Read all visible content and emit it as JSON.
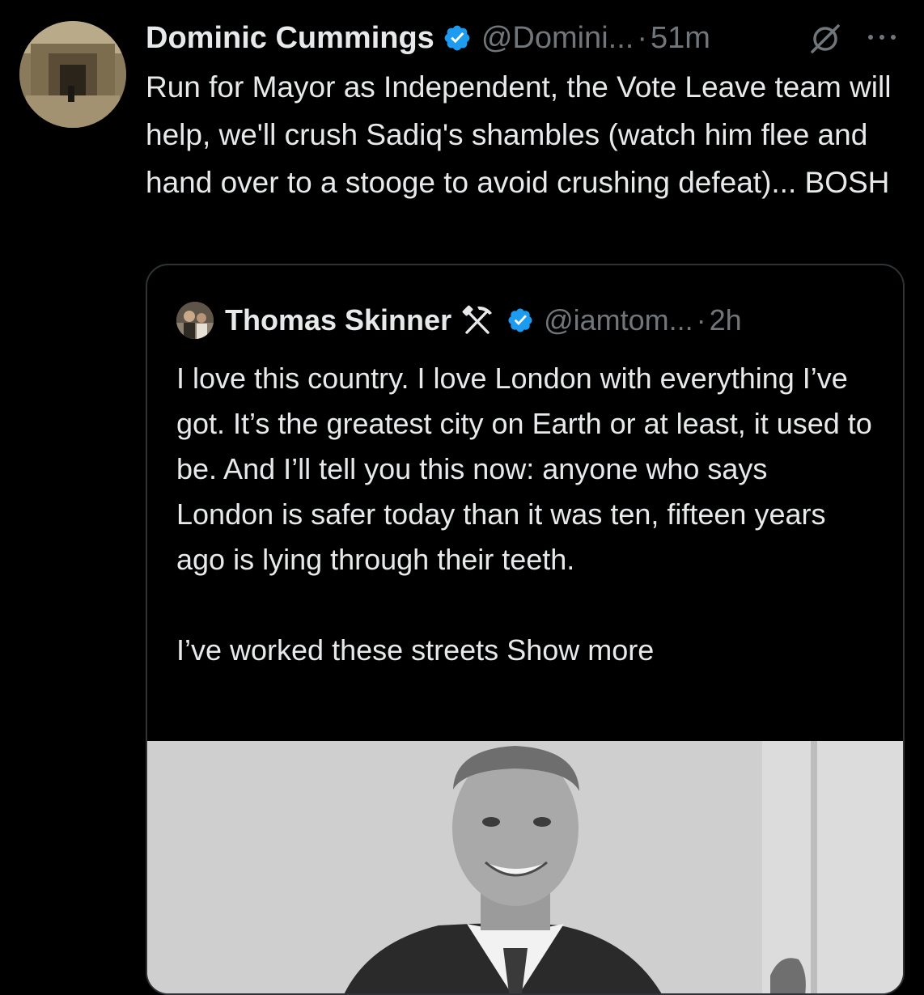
{
  "tweet": {
    "display_name": "Dominic Cummings",
    "handle": "@Domini...",
    "separator": "·",
    "time": "51m",
    "text": "Run for Mayor as Independent, the Vote Leave team will help, we'll crush Sadiq's shambles (watch him flee and hand over to a stooge to avoid crushing defeat)... BOSH",
    "icons": {
      "verified": "verified-badge-icon",
      "grok": "grok-icon",
      "more": "more-options-icon"
    },
    "colors": {
      "background": "#000000",
      "text": "#e7e9ea",
      "secondary": "#71767b",
      "verified": "#1d9bf0",
      "border": "#2f3336"
    }
  },
  "quote": {
    "display_name": "Thomas Skinner",
    "name_emoji": "⚒",
    "handle": "@iamtom...",
    "separator": "·",
    "time": "2h",
    "paragraph_1": "I love this country. I love London with everything I’ve got. It’s the greatest city on Earth or at least, it used to be. And I’ll tell you this now: anyone who says London is safer today than it was ten, fifteen years ago is lying through their teeth.",
    "paragraph_2": "I’ve worked these streets",
    "show_more": "Show more",
    "media": "photo-of-man-in-suit"
  }
}
